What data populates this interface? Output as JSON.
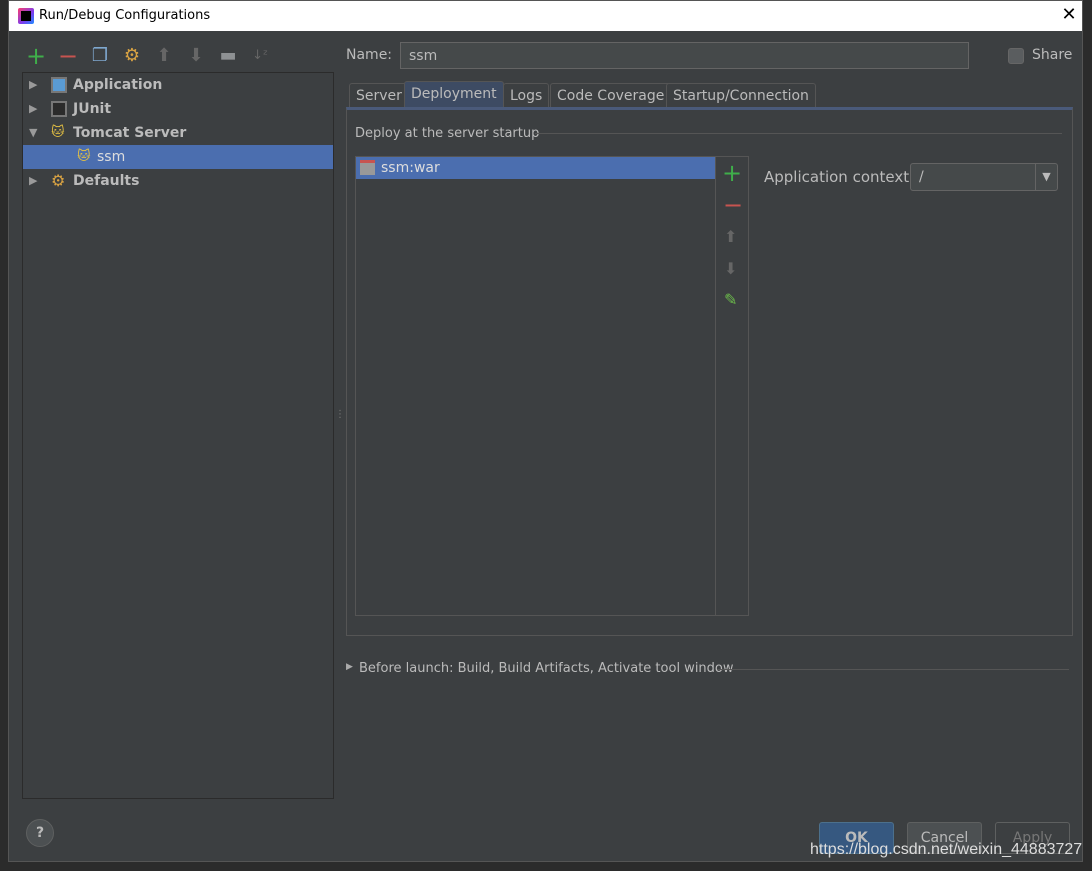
{
  "window": {
    "title": "Run/Debug Configurations"
  },
  "toolbar": {
    "icons": [
      "add-icon",
      "remove-icon",
      "copy-icon",
      "edit-defaults-icon",
      "move-up-icon",
      "move-down-icon",
      "folder-icon",
      "sort-icon"
    ]
  },
  "tree": {
    "items": [
      {
        "label": "Application",
        "expanded": false
      },
      {
        "label": "JUnit",
        "expanded": false
      },
      {
        "label": "Tomcat Server",
        "expanded": true
      },
      {
        "label": "ssm",
        "selected": true
      },
      {
        "label": "Defaults",
        "expanded": false
      }
    ]
  },
  "name": {
    "label": "Name:",
    "value": "ssm"
  },
  "share": {
    "label": "Share",
    "checked": false
  },
  "tabs": [
    {
      "label": "Server"
    },
    {
      "label": "Deployment",
      "active": true
    },
    {
      "label": "Logs"
    },
    {
      "label": "Code Coverage"
    },
    {
      "label": "Startup/Connection"
    }
  ],
  "deployment": {
    "section_title": "Deploy at the server startup",
    "artifacts": [
      {
        "label": "ssm:war",
        "selected": true
      }
    ],
    "context_label": "Application context:",
    "context_value": "/"
  },
  "before_launch": "Before launch: Build, Build Artifacts, Activate tool window",
  "buttons": {
    "ok": "OK",
    "cancel": "Cancel",
    "apply": "Apply",
    "help": "?"
  },
  "watermark": "https://blog.csdn.net/weixin_44883727",
  "colors": {
    "selection": "#4b6eaf",
    "add": "#3fae4a",
    "remove": "#c75450",
    "background": "#3c3f41"
  }
}
